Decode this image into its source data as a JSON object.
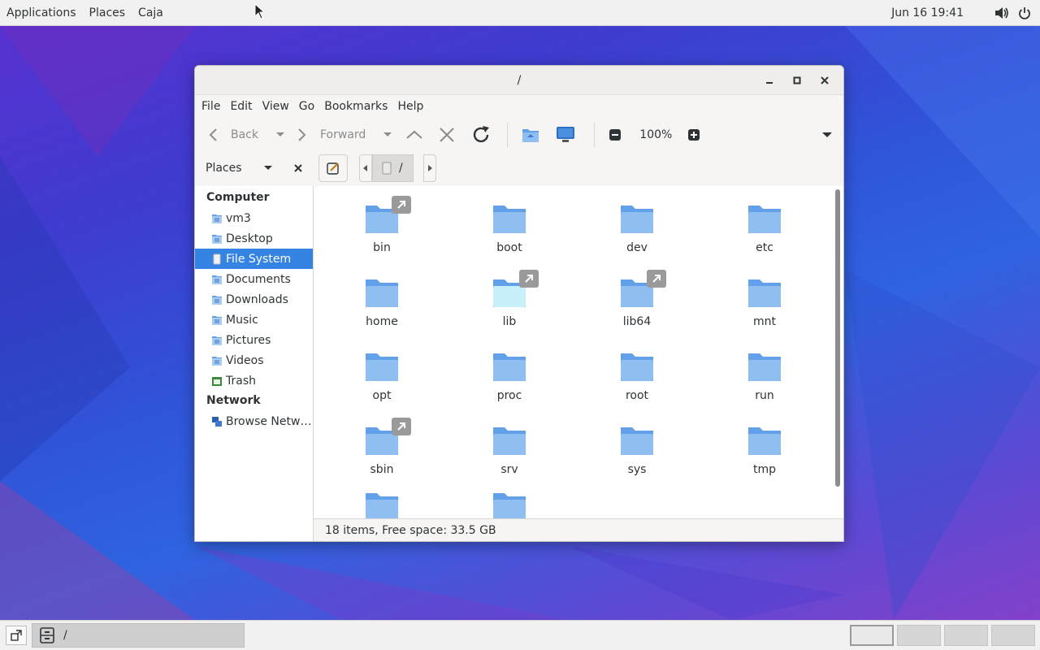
{
  "top_panel": {
    "menus": [
      "Applications",
      "Places",
      "Caja"
    ],
    "clock": "Jun 16  19:41",
    "icons": [
      "volume-icon",
      "power-icon"
    ]
  },
  "window": {
    "title": "/",
    "buttons": [
      "minimize-icon",
      "maximize-icon",
      "close-icon"
    ],
    "menubar": [
      "File",
      "Edit",
      "View",
      "Go",
      "Bookmarks",
      "Help"
    ],
    "toolbar": {
      "back_label": "Back",
      "forward_label": "Forward",
      "zoom": "100%"
    },
    "location": {
      "places_label": "Places",
      "crumb": "/"
    },
    "sidebar": {
      "computer_heading": "Computer",
      "computer_items": [
        {
          "label": "vm3",
          "icon": "home-folder-icon"
        },
        {
          "label": "Desktop",
          "icon": "desktop-folder-icon"
        },
        {
          "label": "File System",
          "icon": "drive-icon"
        },
        {
          "label": "Documents",
          "icon": "documents-folder-icon"
        },
        {
          "label": "Downloads",
          "icon": "downloads-folder-icon"
        },
        {
          "label": "Music",
          "icon": "music-folder-icon"
        },
        {
          "label": "Pictures",
          "icon": "pictures-folder-icon"
        },
        {
          "label": "Videos",
          "icon": "videos-folder-icon"
        },
        {
          "label": "Trash",
          "icon": "trash-icon"
        }
      ],
      "network_heading": "Network",
      "network_items": [
        {
          "label": "Browse Netw…",
          "icon": "network-icon"
        }
      ]
    },
    "files": [
      {
        "name": "bin",
        "link": true
      },
      {
        "name": "boot",
        "link": false
      },
      {
        "name": "dev",
        "link": false
      },
      {
        "name": "etc",
        "link": false
      },
      {
        "name": "home",
        "link": false
      },
      {
        "name": "lib",
        "link": true
      },
      {
        "name": "lib64",
        "link": true
      },
      {
        "name": "mnt",
        "link": false
      },
      {
        "name": "opt",
        "link": false
      },
      {
        "name": "proc",
        "link": false
      },
      {
        "name": "root",
        "link": false
      },
      {
        "name": "run",
        "link": false
      },
      {
        "name": "sbin",
        "link": true
      },
      {
        "name": "srv",
        "link": false
      },
      {
        "name": "sys",
        "link": false
      },
      {
        "name": "tmp",
        "link": false
      },
      {
        "name": "",
        "link": false
      },
      {
        "name": "",
        "link": false
      }
    ],
    "status": "18 items, Free space: 33.5 GB"
  },
  "bottom_panel": {
    "task_label": "/",
    "workspaces": 4
  },
  "colors": {
    "selection": "#3584e4",
    "folder": "#62a0ea"
  }
}
